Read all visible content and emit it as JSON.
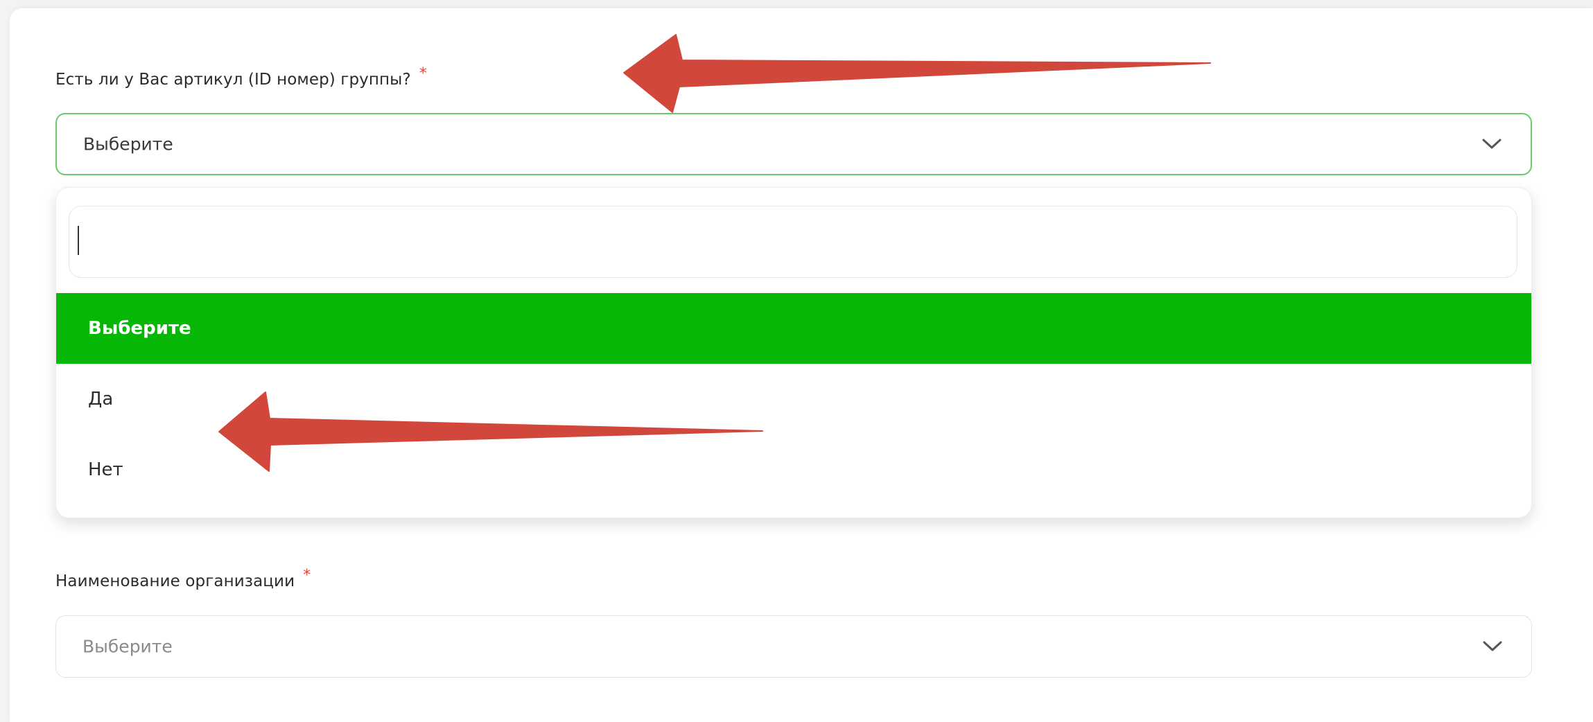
{
  "colors": {
    "accent_green": "#06b706",
    "focus_border": "#6cc96a",
    "required_star": "#e0463c",
    "annotation_arrow": "#d2473b"
  },
  "group_id_field": {
    "label": "Есть ли у Вас артикул (ID номер) группы?",
    "required_mark": "*",
    "value": "Выберите",
    "icon": "chevron-down-icon"
  },
  "dropdown": {
    "search_value": "",
    "options": [
      {
        "label": "Выберите",
        "selected": true
      },
      {
        "label": "Да",
        "selected": false
      },
      {
        "label": "Нет",
        "selected": false
      }
    ]
  },
  "organization_field": {
    "label": "Наименование организации",
    "required_mark": "*",
    "value": "Выберите",
    "icon": "chevron-down-icon"
  },
  "annotations": [
    {
      "icon": "red-arrow-icon",
      "points_to": "group_id_field.label"
    },
    {
      "icon": "red-arrow-icon",
      "points_to": "dropdown.options"
    }
  ]
}
